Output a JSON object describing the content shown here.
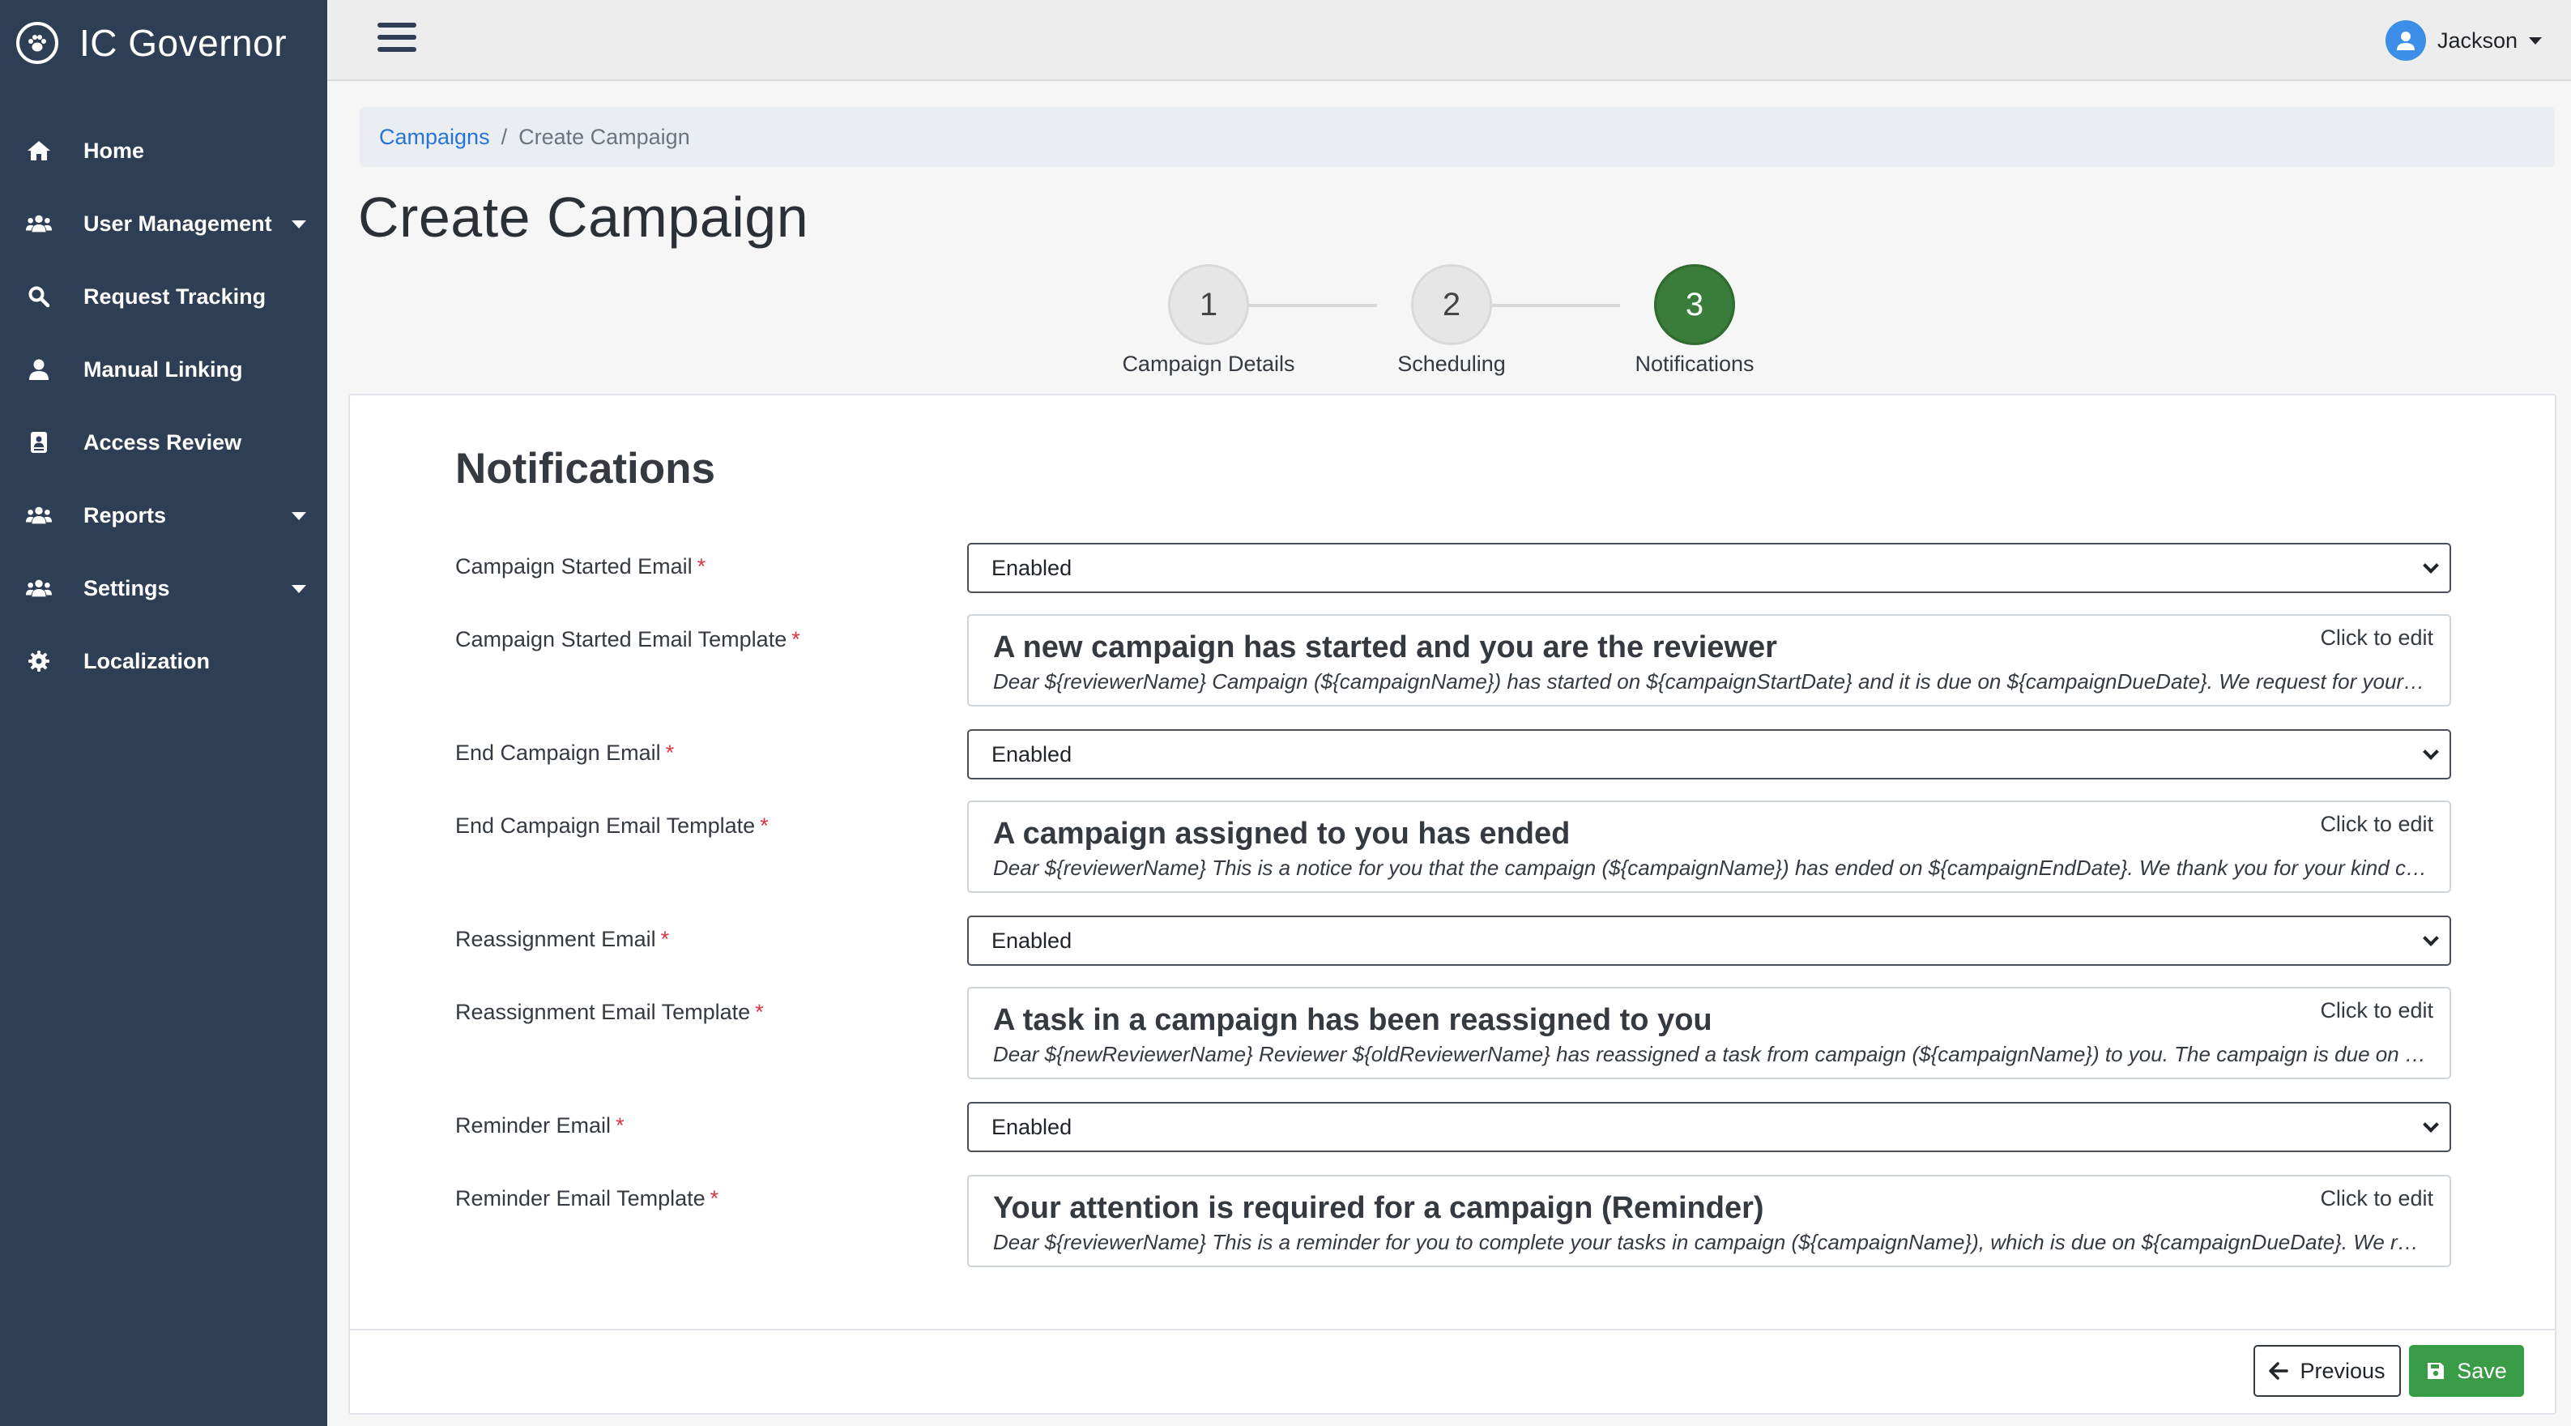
{
  "app": {
    "title": "IC Governor"
  },
  "sidebar": {
    "items": [
      {
        "label": "Home",
        "icon": "home-icon"
      },
      {
        "label": "User Management",
        "icon": "users-icon"
      },
      {
        "label": "Request Tracking",
        "icon": "search-icon"
      },
      {
        "label": "Manual Linking",
        "icon": "user-icon"
      },
      {
        "label": "Access Review",
        "icon": "id-badge-icon"
      },
      {
        "label": "Reports",
        "icon": "users-icon"
      },
      {
        "label": "Settings",
        "icon": "users-icon"
      },
      {
        "label": "Localization",
        "icon": "gear-icon"
      }
    ]
  },
  "header": {
    "user_name": "Jackson"
  },
  "breadcrumb": {
    "parent": "Campaigns",
    "separator": "/",
    "current": "Create Campaign"
  },
  "page": {
    "title": "Create Campaign"
  },
  "stepper": {
    "active_step": 3,
    "steps": [
      {
        "number": "1",
        "label": "Campaign Details"
      },
      {
        "number": "2",
        "label": "Scheduling"
      },
      {
        "number": "3",
        "label": "Notifications"
      }
    ]
  },
  "form": {
    "section_title": "Notifications",
    "required_marker": "*",
    "click_to_edit": "Click to edit",
    "rows": [
      {
        "label": "Campaign Started Email",
        "value": "Enabled"
      },
      {
        "label": "Campaign Started Email Template",
        "subject": "A new campaign has started and you are the reviewer",
        "body": "Dear ${reviewerName} Campaign (${campaignName}) has started on ${campaignStartDate} and it is due on ${campaignDueDate}. We request for your kind support"
      },
      {
        "label": "End Campaign Email",
        "value": "Enabled"
      },
      {
        "label": "End Campaign Email Template",
        "subject": "A campaign assigned to you has ended",
        "body": "Dear ${reviewerName} This is a notice for you that the campaign (${campaignName}) has ended on ${campaignEndDate}. We thank you for your kind cooperation"
      },
      {
        "label": "Reassignment Email",
        "value": "Enabled"
      },
      {
        "label": "Reassignment Email Template",
        "subject": "A task in a campaign has been reassigned to you",
        "body": "Dear ${newReviewerName} Reviewer ${oldReviewerName} has reassigned a task from campaign (${campaignName}) to you. The campaign is due on ${campaignDueDate}"
      },
      {
        "label": "Reminder Email",
        "value": "Enabled"
      },
      {
        "label": "Reminder Email Template",
        "subject": "Your attention is required for a campaign (Reminder)",
        "body": "Dear ${reviewerName} This is a reminder for you to complete your tasks in campaign (${campaignName}), which is due on ${campaignDueDate}. We request your kind support"
      }
    ]
  },
  "footer": {
    "previous_label": "Previous",
    "save_label": "Save"
  },
  "colors": {
    "sidebar_bg": "#2e3e54",
    "active_step": "#3a7d3a",
    "save_button": "#3a9c47",
    "link": "#2774d8",
    "required": "#dc3545"
  }
}
